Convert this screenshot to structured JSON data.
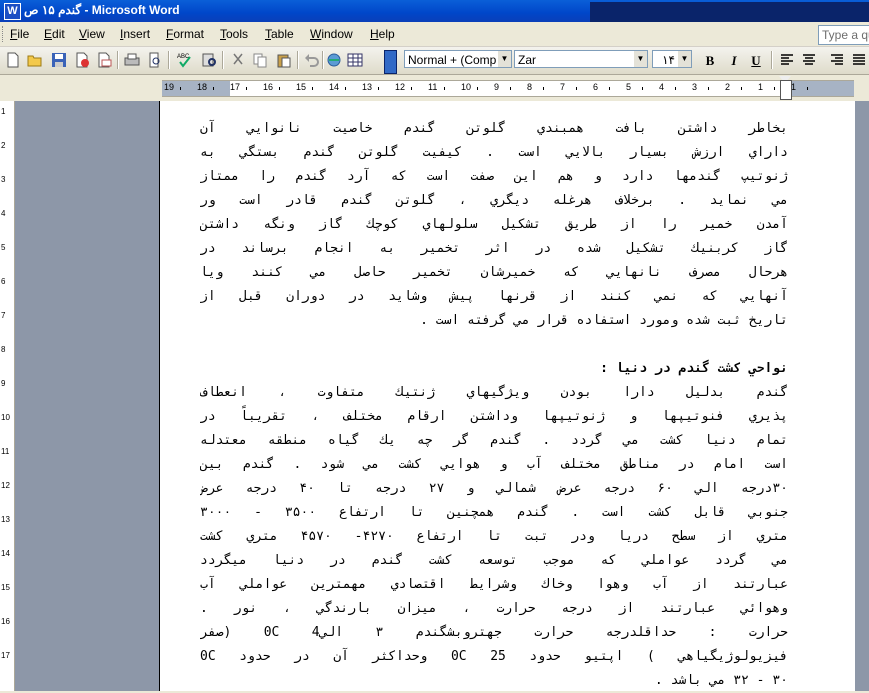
{
  "window": {
    "title": "گندم ۱۵ ص - Microsoft Word"
  },
  "menu": [
    "File",
    "Edit",
    "View",
    "Insert",
    "Format",
    "Tools",
    "Table",
    "Window",
    "Help"
  ],
  "ask": {
    "placeholder": "Type a qu"
  },
  "toolbar": {
    "style_value": "Normal + (Comp",
    "font_value": "Zar",
    "size_value": "۱۴",
    "bold": "B",
    "italic": "I",
    "underline": "U",
    "icons": [
      "new-icon",
      "open-icon",
      "save-icon",
      "permission-icon",
      "email-icon",
      "print-icon",
      "print-preview-icon",
      "spelling-icon",
      "research-icon",
      "cut-icon",
      "copy-icon",
      "paste-icon",
      "undo-icon",
      "hyperlink-icon",
      "table-icon"
    ]
  },
  "ruler": {
    "labels": [
      "19",
      "18",
      "17",
      "16",
      "15",
      "14",
      "13",
      "12",
      "11",
      "10",
      "9",
      "8",
      "7",
      "6",
      "5",
      "4",
      "3",
      "2",
      "1",
      "1"
    ]
  },
  "vruler": {
    "labels": [
      "1",
      "2",
      "3",
      "4",
      "5",
      "6",
      "7",
      "8",
      "9",
      "10",
      "11",
      "12",
      "13",
      "14",
      "15",
      "16",
      "17"
    ]
  },
  "document": {
    "para1": [
      "بخاطر داشتن بافت همبندي گلوتن گندم خاصيت نانوايي آن",
      "داراي ارزش بسيار بالايي است . كيفيت گلوتن گندم بستگي به",
      "ژنوتيپ گندمها دارد و هم اين صفت است كه آرد گندم را ممتاز",
      "مي نمايد . برخلاف هرغله ديگري ، گلوتن گندم قادر است ور",
      "آمدن خمير را از طريق تشكيل سلولهاي كوچك گاز ونگه داشتن",
      "گاز كربنيك تشكيل شده در اثر تخمير به انجام برساند در",
      "هرحال مصرف نانهايي كه خميرشان تخمير حاصل مي كنند ويا",
      "آنهايي كه نمي كنند از قرنها پيش وشايد در دوران قبل از",
      "تاريخ ثبت شده ومورد استفاده قرار مي گرفته است ."
    ],
    "heading": "نواحي كشت گندم در دنيا :",
    "para2": [
      "گندم بدليل دارا بودن ويژگيهاي ژنتيك متفاوت ، انعطاف",
      "پذيري فنوتيپها و ژنوتيپها وداشتن ارقام مختلف ، تقريباً در",
      "تمام دنيا كشت مي گردد . گندم گر چه يك گياه منطقه معتدله",
      "است امام در مناطق مختلف آب و هوايي كشت مي شود . گندم بين",
      "۳۰درجه الي ۶۰ درجه عرض شمالي و ۲۷ درجه تا ۴۰ درجه عرض",
      "جنوبي قابل كشت است . گندم همچنين تا ارتفاع ۳۵۰۰ - ۳۰۰۰",
      "متري از سطح دريا ودر تبت تا ارتفاع ۴۲۷۰- ۴۵۷۰ متري كشت",
      "مي گردد عواملي كه موجب توسعه كشت گندم در دنيا ميگردد",
      "عبارتند از آب وهوا وخاك وشرايط اقتصادي مهمترين عواملي آب",
      "وهوائي عبارتند از درجه حرارت ، ميزان بارندگي ، نور .",
      "حرارت : حداقلدرجه حرارت جهتروبشگندم ۳ الي4 0C  (صفر",
      "فيزيولوژيگياهي ) اپتيو حدود 25 0C وحداكثر آن در حدود 0C",
      "۳۰ - ۳۲ مي باشد ."
    ]
  }
}
